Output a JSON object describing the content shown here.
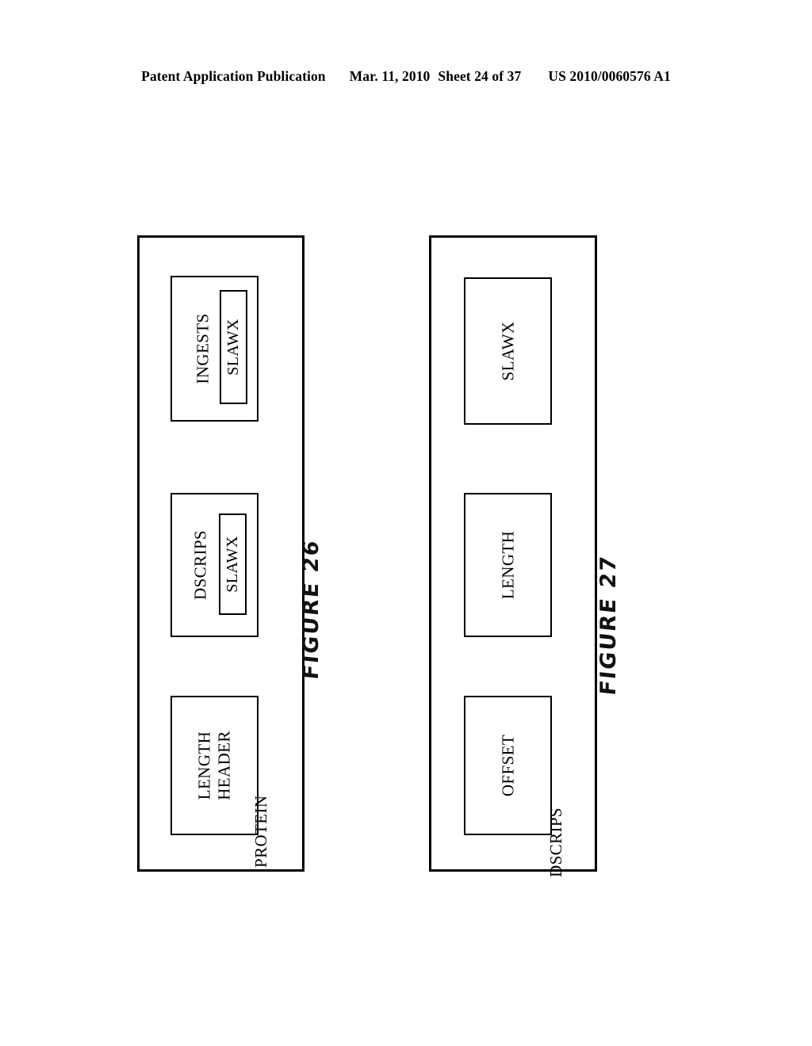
{
  "header": {
    "publication": "Patent Application Publication",
    "date": "Mar. 11, 2010",
    "sheet": "Sheet 24 of 37",
    "patent_number": "US 2010/0060576 A1"
  },
  "figures": [
    {
      "id": "figure-26",
      "caption": "FIGURE 26",
      "container_label": "PROTEIN",
      "blocks": [
        {
          "id": "ingests",
          "label": "INGESTS",
          "nested": {
            "id": "ingests-slawx",
            "label": "SLAWX"
          }
        },
        {
          "id": "dscrips",
          "label": "DSCRIPS",
          "nested": {
            "id": "dscrips-slawx",
            "label": "SLAWX"
          }
        },
        {
          "id": "length-header",
          "label_line1": "LENGTH",
          "label_line2": "HEADER"
        }
      ]
    },
    {
      "id": "figure-27",
      "caption": "FIGURE 27",
      "container_label": "DSCRIPS",
      "blocks": [
        {
          "id": "slawx",
          "label": "SLAWX"
        },
        {
          "id": "length",
          "label": "LENGTH"
        },
        {
          "id": "offset",
          "label": "OFFSET"
        }
      ]
    }
  ],
  "colors": {
    "ink": "#000000",
    "paper": "#ffffff"
  }
}
